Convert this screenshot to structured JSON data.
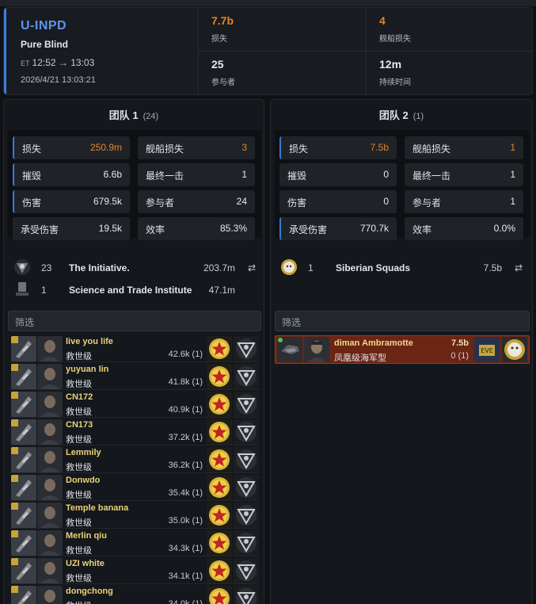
{
  "header": {
    "system": "U-INPD",
    "region": "Pure Blind",
    "et_label": "ET",
    "et_range": "12:52 → 13:03",
    "timestamp": "2026/4/21 13:03:21",
    "stats": [
      {
        "value": "7.7b",
        "label": "损失"
      },
      {
        "value": "4",
        "label": "舰船损失"
      },
      {
        "value": "25",
        "label": "参与者"
      },
      {
        "value": "12m",
        "label": "持续时间"
      }
    ]
  },
  "team1": {
    "title": "团队 1",
    "count": "(24)",
    "stats": [
      {
        "k": "损失",
        "v": "250.9m"
      },
      {
        "k": "舰船损失",
        "v": "3"
      },
      {
        "k": "摧毁",
        "v": "6.6b"
      },
      {
        "k": "最终一击",
        "v": "1"
      },
      {
        "k": "伤害",
        "v": "679.5k"
      },
      {
        "k": "参与者",
        "v": "24"
      },
      {
        "k": "承受伤害",
        "v": "19.5k"
      },
      {
        "k": "效率",
        "v": "85.3%"
      }
    ],
    "alliances": [
      {
        "n": "23",
        "name": "The Initiative.",
        "isk": "203.7m"
      },
      {
        "n": "1",
        "name": "Science and Trade Institute",
        "isk": "47.1m"
      }
    ],
    "filter_placeholder": "筛选",
    "pilots": [
      {
        "name": "live you life",
        "ship": "救世级",
        "value": "42.6k (1)"
      },
      {
        "name": "yuyuan lin",
        "ship": "救世级",
        "value": "41.8k (1)"
      },
      {
        "name": "CN172",
        "ship": "救世级",
        "value": "40.9k (1)"
      },
      {
        "name": "CN173",
        "ship": "救世级",
        "value": "37.2k (1)"
      },
      {
        "name": "Lemmily",
        "ship": "救世级",
        "value": "36.2k (1)"
      },
      {
        "name": "Donwdo",
        "ship": "救世级",
        "value": "35.4k (1)"
      },
      {
        "name": "Temple banana",
        "ship": "救世级",
        "value": "35.0k (1)"
      },
      {
        "name": "Merlin qiu",
        "ship": "救世级",
        "value": "34.3k (1)"
      },
      {
        "name": "UZI white",
        "ship": "救世级",
        "value": "34.1k (1)"
      },
      {
        "name": "dongchong",
        "ship": "救世级",
        "value": "34.0k (1)"
      }
    ]
  },
  "team2": {
    "title": "团队 2",
    "count": "(1)",
    "stats": [
      {
        "k": "损失",
        "v": "7.5b"
      },
      {
        "k": "舰船损失",
        "v": "1"
      },
      {
        "k": "摧毁",
        "v": "0"
      },
      {
        "k": "最终一击",
        "v": "1"
      },
      {
        "k": "伤害",
        "v": "0"
      },
      {
        "k": "参与者",
        "v": "1"
      },
      {
        "k": "承受伤害",
        "v": "770.7k"
      },
      {
        "k": "效率",
        "v": "0.0%"
      }
    ],
    "alliances": [
      {
        "n": "1",
        "name": "Siberian Squads",
        "isk": "7.5b"
      }
    ],
    "filter_placeholder": "筛选",
    "pilots": [
      {
        "name": "diman Ambramotte",
        "ship": "凤凰级海军型",
        "isk": "7.5b",
        "value": "0 (1)"
      }
    ]
  },
  "colors": {
    "accent": "#3e7be0",
    "orange": "#e5832b",
    "pilot_name": "#e8d27a",
    "loss_row": "#6a2515"
  },
  "icons": {
    "share": "share-icon",
    "ship": "ship-icon",
    "corp": "star-corp-icon",
    "alliance": "alliance-icon"
  }
}
